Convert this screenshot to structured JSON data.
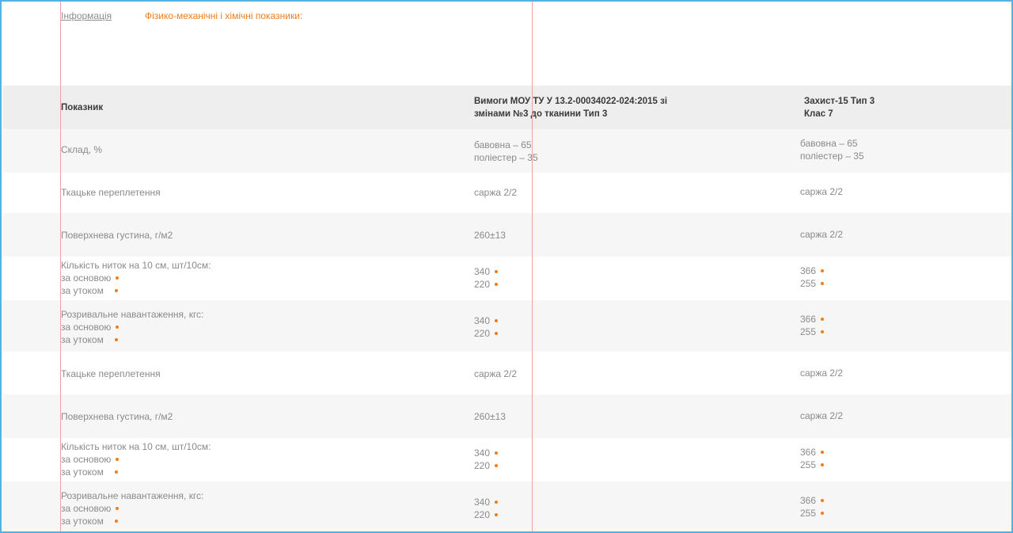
{
  "tabs": {
    "info": "Інформація",
    "phys": "Фізико-механічні і хімічні показники:"
  },
  "table": {
    "headers": {
      "col1": "Показник",
      "col2_line1": "Вимоги  МОУ ТУ У 13.2-00034022-024:2015 зі",
      "col2_line2": "змінами №3 до тканини Тип 3",
      "col3_line1": "Захист-15 Тип 3",
      "col3_line2": " Клас 7"
    },
    "rows": [
      {
        "c1": [
          "Склад, %"
        ],
        "c2": [
          "бавовна – 65",
          "поліестер – 35"
        ],
        "c3": [
          "бавовна – 65",
          " поліестер – 35"
        ]
      },
      {
        "c1": [
          "Ткацьке переплетення"
        ],
        "c2": [
          "саржа 2/2"
        ],
        "c3": [
          "саржа 2/2"
        ]
      },
      {
        "c1": [
          "Поверхнева густина, г/м2"
        ],
        "c2": [
          "260±13"
        ],
        "c3": [
          "саржа 2/2"
        ]
      },
      {
        "c1": [
          "Кількість ниток на 10 см, шт/10см:",
          "за основою",
          "за утоком"
        ],
        "c2": [
          "340",
          "220"
        ],
        "c3": [
          "366",
          "255"
        ]
      },
      {
        "c1": [
          "Розривальне навантаження, кгс:",
          "за основою",
          "за утоком"
        ],
        "c2": [
          "340",
          "220"
        ],
        "c3": [
          "366",
          "255"
        ]
      },
      {
        "c1": [
          "Ткацьке переплетення"
        ],
        "c2": [
          "саржа 2/2"
        ],
        "c3": [
          "саржа 2/2"
        ]
      },
      {
        "c1": [
          "Поверхнева густина, г/м2"
        ],
        "c2": [
          "260±13"
        ],
        "c3": [
          "саржа 2/2"
        ]
      },
      {
        "c1": [
          "Кількість ниток на 10 см, шт/10см:",
          "за основою",
          "за утоком"
        ],
        "c2": [
          "340",
          "220"
        ],
        "c3": [
          "366",
          "255"
        ]
      },
      {
        "c1": [
          "Розривальне навантаження, кгс:",
          "за основою",
          "за утоком"
        ],
        "c2": [
          "340",
          "220"
        ],
        "c3": [
          "366",
          "255"
        ]
      }
    ]
  },
  "colors": {
    "accent": "#f07d1a",
    "header_bg": "#eeeeee",
    "stripe_bg": "#f6f6f6",
    "guide": "#f2a0a0",
    "frame": "#4fb3e6"
  }
}
